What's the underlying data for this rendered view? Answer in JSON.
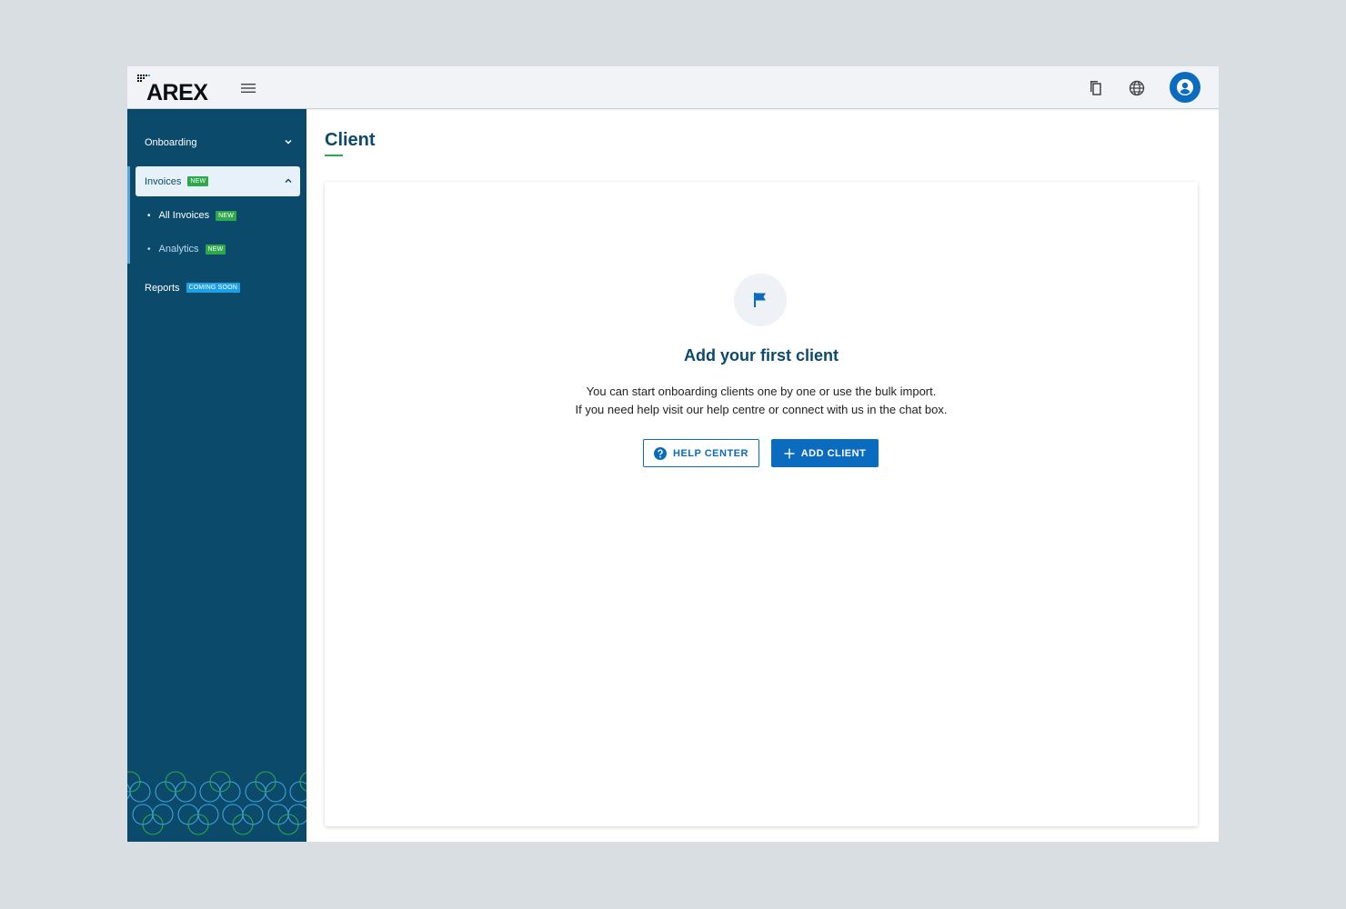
{
  "brand": {
    "name": "AREX"
  },
  "topbar": {
    "icons": [
      "menu-icon",
      "copy-icon",
      "globe-icon",
      "account-icon"
    ]
  },
  "sidebar": {
    "items": [
      {
        "label": "Onboarding",
        "chevron": "chevron-down-icon"
      },
      {
        "label": "Invoices",
        "badge": "NEW",
        "chevron": "chevron-up-icon",
        "expanded": true
      },
      {
        "label": "Reports",
        "badge": "COMING SOON"
      }
    ],
    "subitems": [
      {
        "label": "All Invoices",
        "badge": "NEW"
      },
      {
        "label": "Analytics",
        "badge": "NEW"
      }
    ]
  },
  "main": {
    "title": "Client",
    "empty_state": {
      "icon": "flag-icon",
      "heading": "Add your first client",
      "line1": "You can start onboarding clients one by one or use the bulk import.",
      "line2": "If you need help visit our help centre or connect with us in the chat box.",
      "help_button": "HELP CENTER",
      "add_button": "ADD CLIENT"
    }
  },
  "colors": {
    "sidebar": "#0b4a6b",
    "primary": "#0b6bbf",
    "badge_new": "#2ea84a",
    "badge_soon": "#1ca1e6",
    "background": "#d9dee2"
  }
}
